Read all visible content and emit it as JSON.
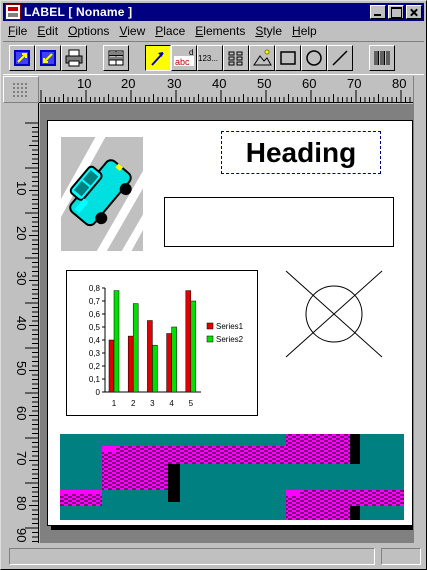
{
  "window": {
    "title": "LABEL [ Noname ]"
  },
  "menu": {
    "items": [
      {
        "label": "File",
        "key": "F",
        "rest": "ile"
      },
      {
        "label": "Edit",
        "key": "E",
        "rest": "dit"
      },
      {
        "label": "Options",
        "key": "O",
        "rest": "ptions"
      },
      {
        "label": "View",
        "key": "V",
        "rest": "iew"
      },
      {
        "label": "Place",
        "key": "P",
        "rest": "lace"
      },
      {
        "label": "Elements",
        "key": "E",
        "rest": "lements"
      },
      {
        "label": "Style",
        "key": "S",
        "rest": "tyle"
      },
      {
        "label": "Help",
        "key": "H",
        "rest": "elp"
      }
    ]
  },
  "toolbar": {
    "buttons": [
      {
        "name": "open-icon"
      },
      {
        "name": "save-icon"
      },
      {
        "name": "print-icon"
      },
      {
        "name": "grid-icon"
      },
      {
        "name": "pointer-icon",
        "pressed": true
      },
      {
        "name": "text-tool-icon",
        "label": "abc"
      },
      {
        "name": "number-tool-icon",
        "label": "123..."
      },
      {
        "name": "list-tool-icon"
      },
      {
        "name": "picture-tool-icon"
      },
      {
        "name": "rectangle-tool-icon"
      },
      {
        "name": "ellipse-tool-icon"
      },
      {
        "name": "line-tool-icon"
      },
      {
        "name": "barcode-tool-icon"
      }
    ]
  },
  "rulers": {
    "horizontal": [
      "10",
      "20",
      "30",
      "40",
      "50",
      "60",
      "70",
      "80"
    ],
    "vertical": [
      "10",
      "20",
      "30",
      "40",
      "50",
      "60",
      "70",
      "80",
      "90"
    ]
  },
  "label": {
    "heading": "Heading",
    "chart": {
      "y_ticks": [
        "0",
        "0,1",
        "0,2",
        "0,3",
        "0,4",
        "0,5",
        "0,6",
        "0,7",
        "0,8"
      ],
      "categories": [
        "1",
        "2",
        "3",
        "4",
        "5"
      ],
      "legend": [
        "Series1",
        "Series2"
      ]
    }
  },
  "chart_data": {
    "type": "bar",
    "categories": [
      "1",
      "2",
      "3",
      "4",
      "5"
    ],
    "series": [
      {
        "name": "Series1",
        "values": [
          0.4,
          0.43,
          0.55,
          0.45,
          0.78
        ]
      },
      {
        "name": "Series2",
        "values": [
          0.78,
          0.68,
          0.36,
          0.5,
          0.7
        ]
      }
    ],
    "ylim": [
      0,
      0.8
    ],
    "colors": [
      "#e00000",
      "#00e000"
    ],
    "legend": "right"
  },
  "colors": {
    "titlebar": "#000080",
    "face": "#c0c0c0",
    "canvas_bg": "#808080",
    "teal": "#008080",
    "magenta": "#ff00ff",
    "purple": "#800080"
  }
}
